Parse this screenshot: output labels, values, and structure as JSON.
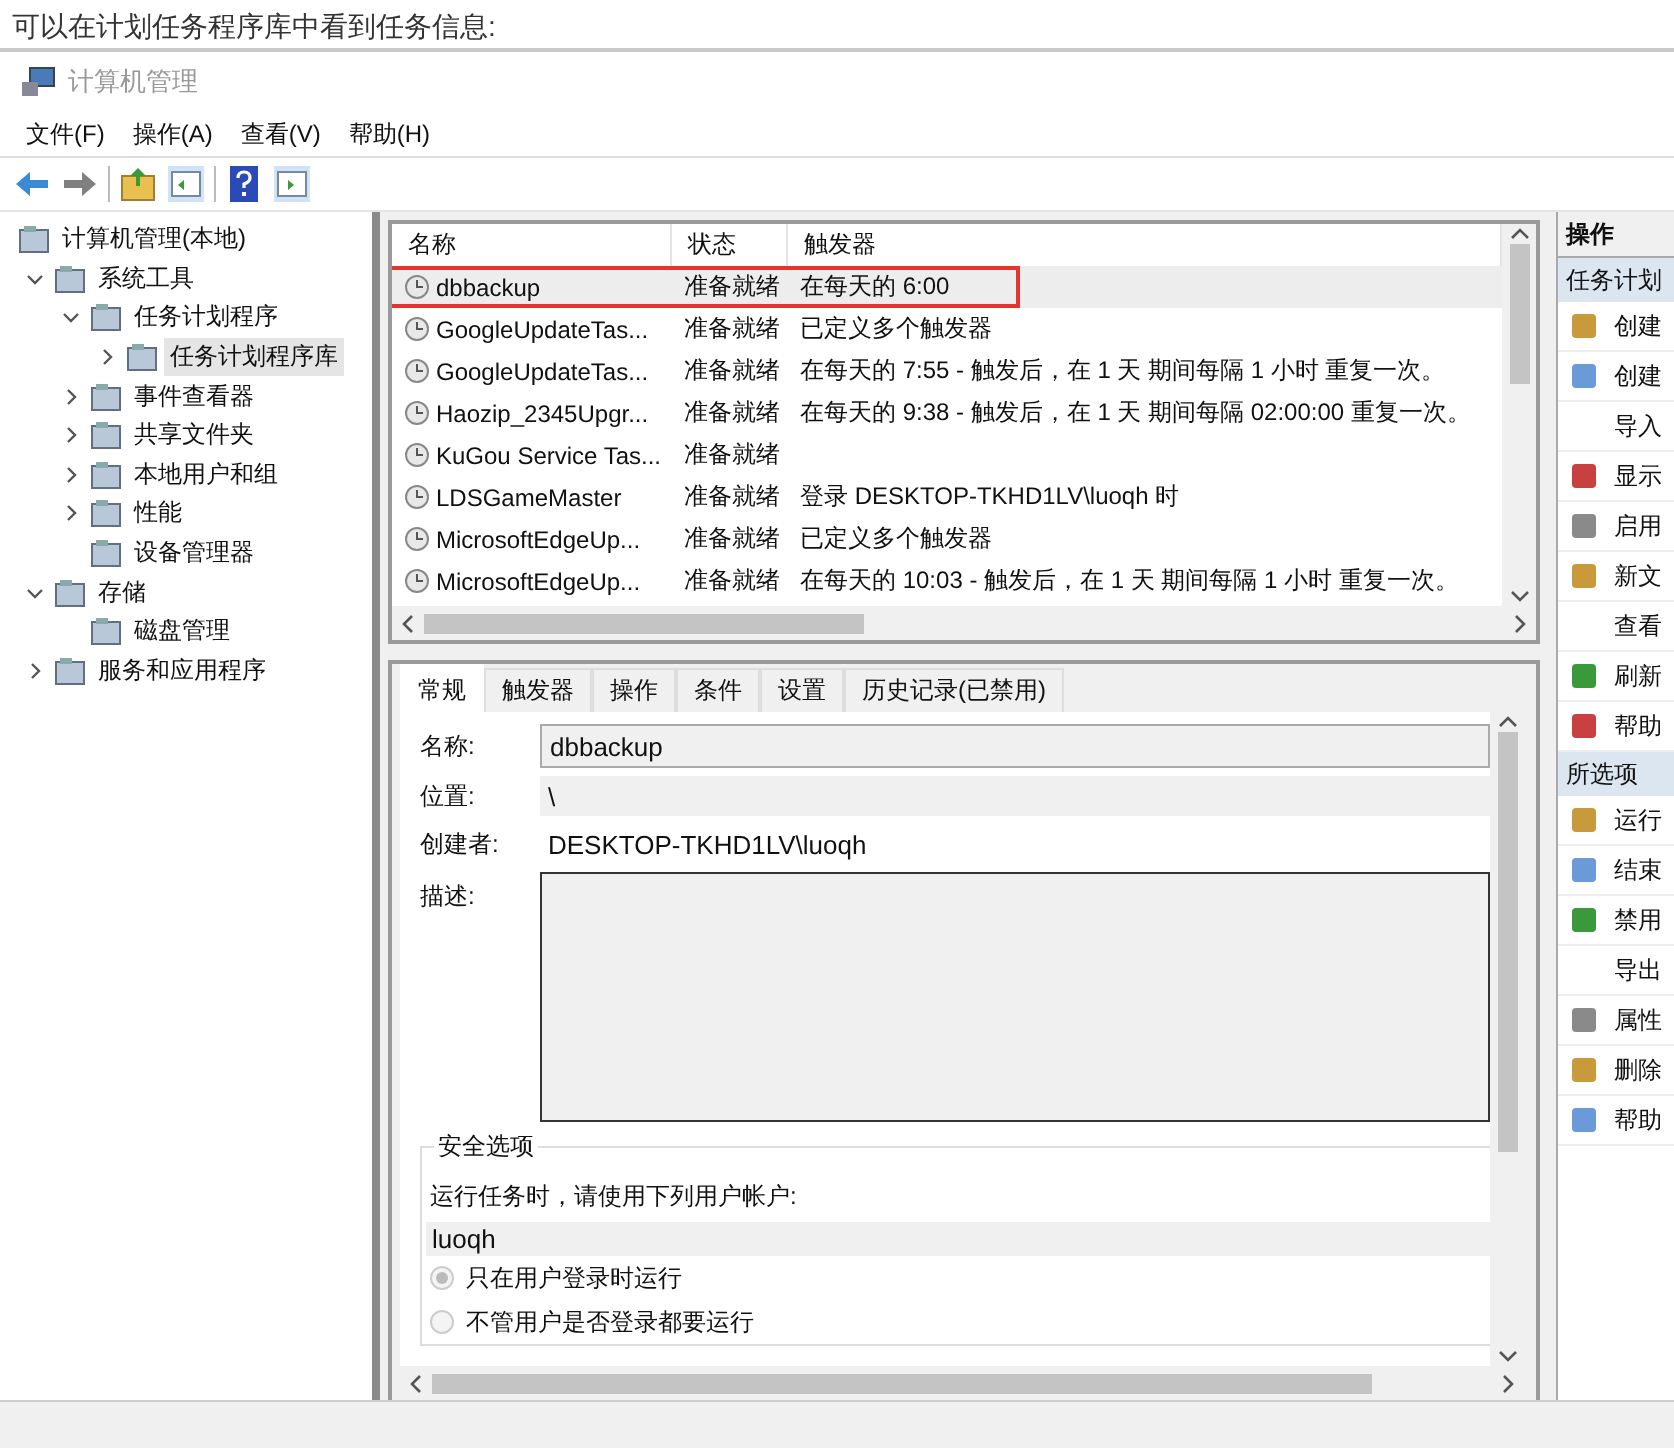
{
  "caption": "可以在计划任务程序库中看到任务信息:",
  "window": {
    "title": "计算机管理"
  },
  "menu": [
    "文件(F)",
    "操作(A)",
    "查看(V)",
    "帮助(H)"
  ],
  "tree": [
    {
      "label": "计算机管理(本地)",
      "selected": false,
      "children": [
        {
          "label": "系统工具",
          "selected": false,
          "expanded": true,
          "children": [
            {
              "label": "任务计划程序",
              "selected": false,
              "expanded": true,
              "children": [
                {
                  "label": "任务计划程序库",
                  "selected": true,
                  "expanded": false
                }
              ]
            },
            {
              "label": "事件查看器",
              "selected": false,
              "expanded": false
            },
            {
              "label": "共享文件夹",
              "selected": false,
              "expanded": false
            },
            {
              "label": "本地用户和组",
              "selected": false,
              "expanded": false
            },
            {
              "label": "性能",
              "selected": false,
              "expanded": false
            },
            {
              "label": "设备管理器",
              "selected": false
            }
          ]
        },
        {
          "label": "存储",
          "selected": false,
          "expanded": true,
          "children": [
            {
              "label": "磁盘管理",
              "selected": false
            }
          ]
        },
        {
          "label": "服务和应用程序",
          "selected": false,
          "expanded": false
        }
      ]
    }
  ],
  "table": {
    "columns": [
      "名称",
      "状态",
      "触发器"
    ],
    "rows": [
      {
        "name": "dbbackup",
        "status": "准备就绪",
        "trigger": "在每天的 6:00",
        "selected": true,
        "highlighted": true
      },
      {
        "name": "GoogleUpdateTas...",
        "status": "准备就绪",
        "trigger": "已定义多个触发器",
        "selected": false,
        "highlighted": false
      },
      {
        "name": "GoogleUpdateTas...",
        "status": "准备就绪",
        "trigger": "在每天的 7:55 - 触发后，在 1 天 期间每隔 1 小时 重复一次。",
        "selected": false,
        "highlighted": false
      },
      {
        "name": "Haozip_2345Upgr...",
        "status": "准备就绪",
        "trigger": "在每天的 9:38 - 触发后，在 1 天 期间每隔 02:00:00 重复一次。",
        "selected": false,
        "highlighted": false
      },
      {
        "name": "KuGou Service Tas...",
        "status": "准备就绪",
        "selected": false,
        "highlighted": false
      },
      {
        "name": "LDSGameMaster",
        "status": "准备就绪",
        "trigger": "登录 DESKTOP-TKHD1LV\\luoqh 时",
        "selected": false,
        "highlighted": false
      },
      {
        "name": "MicrosoftEdgeUp...",
        "status": "准备就绪",
        "trigger": "已定义多个触发器",
        "selected": false,
        "highlighted": false
      },
      {
        "name": "MicrosoftEdgeUp...",
        "status": "准备就绪",
        "trigger": "在每天的 10:03 - 触发后，在 1 天 期间每隔 1 小时 重复一次。",
        "selected": false,
        "highlighted": false
      }
    ]
  },
  "detail_tabs": [
    {
      "label": "常规",
      "selected": true
    },
    {
      "label": "触发器",
      "selected": false
    },
    {
      "label": "操作",
      "selected": false
    },
    {
      "label": "条件",
      "selected": false
    },
    {
      "label": "设置",
      "selected": false
    },
    {
      "label": "历史记录(已禁用)",
      "selected": false
    }
  ],
  "general": {
    "name_label": "名称:",
    "name": "dbbackup",
    "location_label": "位置:",
    "location": "\\",
    "author_label": "创建者:",
    "author": "DESKTOP-TKHD1LV\\luoqh",
    "description_label": "描述:",
    "security": {
      "title": "安全选项",
      "prompt": "运行任务时，请使用下列用户帐户:",
      "account": "luoqh",
      "options": [
        {
          "label": "只在用户登录时运行",
          "selected": true
        },
        {
          "label": "不管用户是否登录都要运行",
          "selected": false
        }
      ]
    }
  },
  "actions": {
    "title": "操作",
    "sections": [
      {
        "title": "任务计划",
        "items": [
          {
            "label": "创建",
            "kind": "icon"
          },
          {
            "label": "创建",
            "kind": "icon"
          },
          {
            "label": "导入",
            "kind": "plain"
          },
          {
            "label": "显示",
            "kind": "icon"
          },
          {
            "label": "启用",
            "kind": "icon"
          },
          {
            "label": "新文",
            "kind": "icon"
          },
          {
            "label": "查看",
            "kind": "plain"
          },
          {
            "label": "刷新",
            "kind": "icon"
          },
          {
            "label": "帮助",
            "kind": "icon"
          }
        ]
      },
      {
        "title": "所选项",
        "items": [
          {
            "label": "运行",
            "kind": "icon"
          },
          {
            "label": "结束",
            "kind": "icon"
          },
          {
            "label": "禁用",
            "kind": "icon"
          },
          {
            "label": "导出",
            "kind": "plain"
          },
          {
            "label": "属性",
            "kind": "icon"
          },
          {
            "label": "删除",
            "kind": "icon"
          },
          {
            "label": "帮助",
            "kind": "icon"
          }
        ]
      }
    ]
  }
}
